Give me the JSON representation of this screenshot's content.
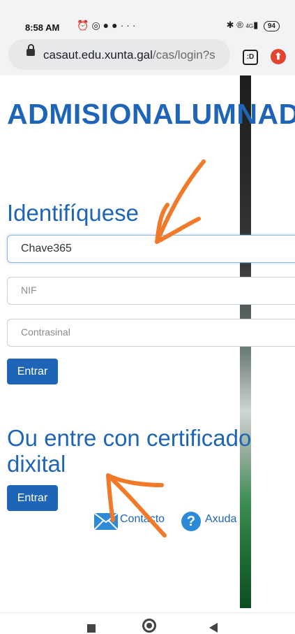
{
  "status_bar": {
    "time": "8:58 AM",
    "left_icons": [
      "alarm-icon",
      "whatsapp-icon",
      "facebook-icon",
      "facebook-icon",
      "more-dots-icon"
    ],
    "right_icons": [
      "bluetooth-icon",
      "registered-icon",
      "signal-4g-icon"
    ],
    "battery": "94",
    "network": "4G"
  },
  "browser": {
    "url_domain": "casaut.edu.xunta.gal",
    "url_path": "/cas/login?s",
    "tab_icon_label": ":D"
  },
  "page": {
    "title": "ADMISIONALUMNAD",
    "login_heading": "Identifíquese",
    "username_value": "Chave365",
    "nif_placeholder": "NIF",
    "password_placeholder": "Contrasinal",
    "submit_label": "Entrar",
    "certificate_heading_line1": "Ou entre con certificado",
    "certificate_heading_line2": "dixital",
    "certificate_button_label": "Entrar",
    "contact_label": "Contacto",
    "help_label": "Axuda"
  },
  "annotations": {
    "arrow_color": "#f07a2a"
  },
  "nav_bar": {
    "icons": [
      "recents-square-icon",
      "home-circle-icon",
      "back-triangle-icon"
    ]
  }
}
